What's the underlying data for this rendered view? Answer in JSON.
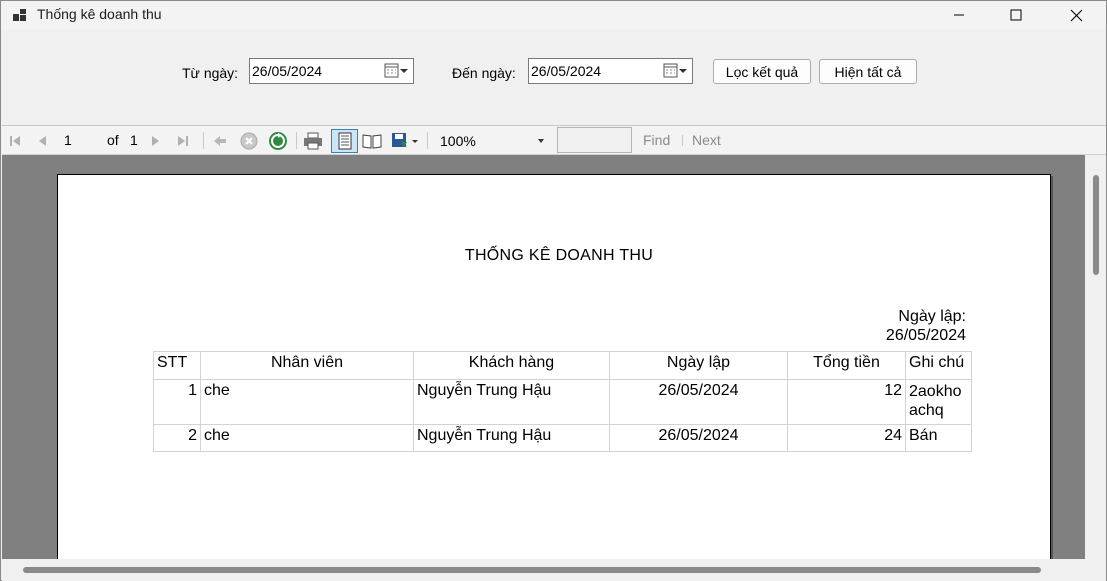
{
  "window": {
    "title": "Thống kê doanh thu"
  },
  "filter": {
    "from_label": "Từ ngày:",
    "from_value": "26/05/2024",
    "to_label": "Đến ngày:",
    "to_value": "26/05/2024",
    "filter_button": "Lọc kết quả",
    "show_all_button": "Hiện tất cả"
  },
  "toolbar": {
    "page_current": "1",
    "page_of": "of",
    "page_total": "1",
    "zoom": "100%",
    "find_value": "",
    "find_label": "Find",
    "next_label": "Next"
  },
  "report": {
    "title": "THỐNG KÊ DOANH THU",
    "date_label": "Ngày lập:",
    "date_value": "26/05/2024",
    "columns": [
      "STT",
      "Nhân viên",
      "Khách hàng",
      "Ngày lập",
      "Tổng tiền",
      "Ghi chú"
    ],
    "rows": [
      {
        "stt": "1",
        "nhan_vien": "che",
        "khach_hang": "Nguyễn Trung Hậu",
        "ngay_lap": "26/05/2024",
        "tong_tien": "12",
        "ghi_chu": "2aokhoachq"
      },
      {
        "stt": "2",
        "nhan_vien": "che",
        "khach_hang": "Nguyễn Trung Hậu",
        "ngay_lap": "26/05/2024",
        "tong_tien": "24",
        "ghi_chu": "Bán"
      }
    ]
  },
  "colors": {
    "canvas_bg": "#808080",
    "window_bg": "#f0f0f0",
    "table_border": "#d3d3d3"
  }
}
